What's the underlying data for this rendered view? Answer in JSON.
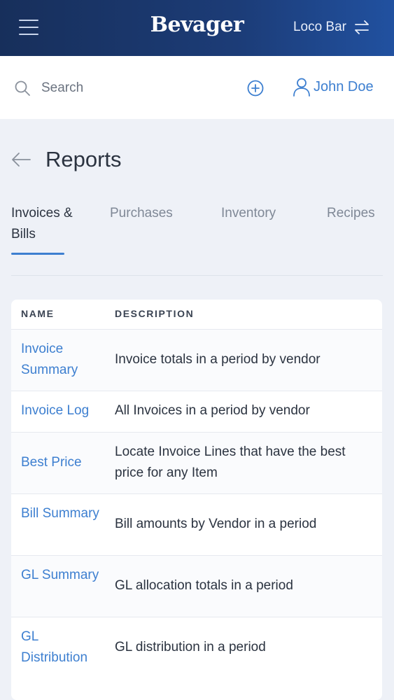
{
  "header": {
    "logo": "Bevager",
    "venue": "Loco Bar"
  },
  "search": {
    "placeholder": "Search"
  },
  "user": {
    "name": "John Doe"
  },
  "page": {
    "title": "Reports"
  },
  "tabs": [
    {
      "label": "Invoices & Bills",
      "active": true
    },
    {
      "label": "Purchases",
      "active": false
    },
    {
      "label": "Inventory",
      "active": false
    },
    {
      "label": "Recipes",
      "active": false
    }
  ],
  "table": {
    "headers": {
      "name": "NAME",
      "description": "DESCRIPTION"
    },
    "rows": [
      {
        "name": "Invoice Summary",
        "description": "Invoice totals in a period by vendor"
      },
      {
        "name": "Invoice Log",
        "description": "All Invoices in a period by vendor"
      },
      {
        "name": "Best Price",
        "description": "Locate Invoice Lines that have the best price for any Item"
      },
      {
        "name": "Bill Summary",
        "description": "Bill amounts by Vendor in a period"
      },
      {
        "name": "GL Summary",
        "description": "GL allocation totals in a period"
      },
      {
        "name": "GL Distribution",
        "description": "GL distribution in a period"
      }
    ]
  },
  "colors": {
    "header_gradient_start": "#172f5b",
    "header_gradient_end": "#2151a0",
    "accent": "#3d7fd0",
    "background": "#eef1f7"
  },
  "icons": {
    "menu": "hamburger-menu-icon",
    "switch": "switch-arrows-icon",
    "search": "search-icon",
    "add": "plus-circle-icon",
    "user": "user-icon",
    "back": "arrow-left-icon"
  }
}
